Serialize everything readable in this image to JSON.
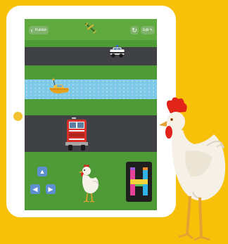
{
  "app": {
    "back_label": "Publish",
    "back_icon": "chevron-left-icon",
    "restart_icon": "restart-icon",
    "edit_label": "Edit",
    "edit_icon": "pencil-icon"
  },
  "colors": {
    "background": "#F7C10A",
    "tablet": "#FFFFFF",
    "grass": "#4E9A37",
    "road": "#3F4144",
    "water": "#7EC8E8",
    "button": "#7FB36A",
    "dpad": "#5E8FD0"
  },
  "game": {
    "sprites": [
      "airplane-icon",
      "police-car-icon",
      "yellow-boat-icon",
      "fire-truck-icon",
      "chicken-icon",
      "h-letter-block-icon"
    ],
    "controls": [
      "arrow-up-icon",
      "arrow-left-icon",
      "arrow-right-icon"
    ]
  }
}
